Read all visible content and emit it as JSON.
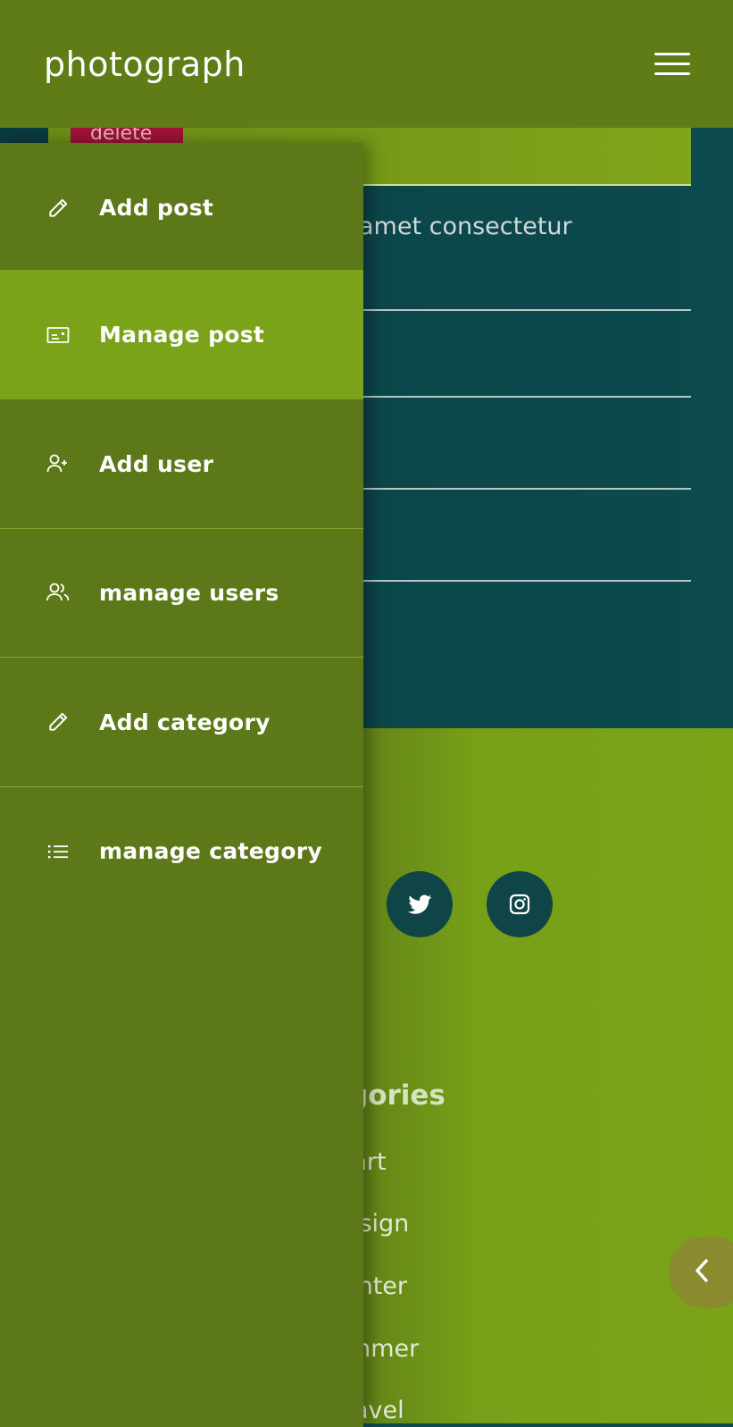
{
  "header": {
    "brand": "photograph",
    "menu_icon": "hamburger-icon"
  },
  "post": {
    "delete_label": "delete",
    "excerpt": "amet consectetur"
  },
  "drawer": {
    "items": [
      {
        "label": "Add post",
        "icon": "pencil-icon"
      },
      {
        "label": "Manage post",
        "icon": "card-icon",
        "active": true
      },
      {
        "label": "Add user",
        "icon": "user-plus-icon"
      },
      {
        "label": "manage users",
        "icon": "users-icon"
      },
      {
        "label": "Add category",
        "icon": "pencil-icon"
      },
      {
        "label": "manage category",
        "icon": "list-icon"
      }
    ]
  },
  "social": [
    {
      "name": "twitter-icon"
    },
    {
      "name": "instagram-icon"
    }
  ],
  "categories": {
    "heading": "gories",
    "items": [
      "art",
      "design",
      "winter",
      "summer",
      "travel"
    ]
  },
  "colors": {
    "header": "#5f7c17",
    "drawer": "#5d7818",
    "drawer_active": "#7aa31a",
    "teal": "#0d4a4d",
    "delete_badge": "#a0113a",
    "back_tab": "#8a8a2e"
  }
}
